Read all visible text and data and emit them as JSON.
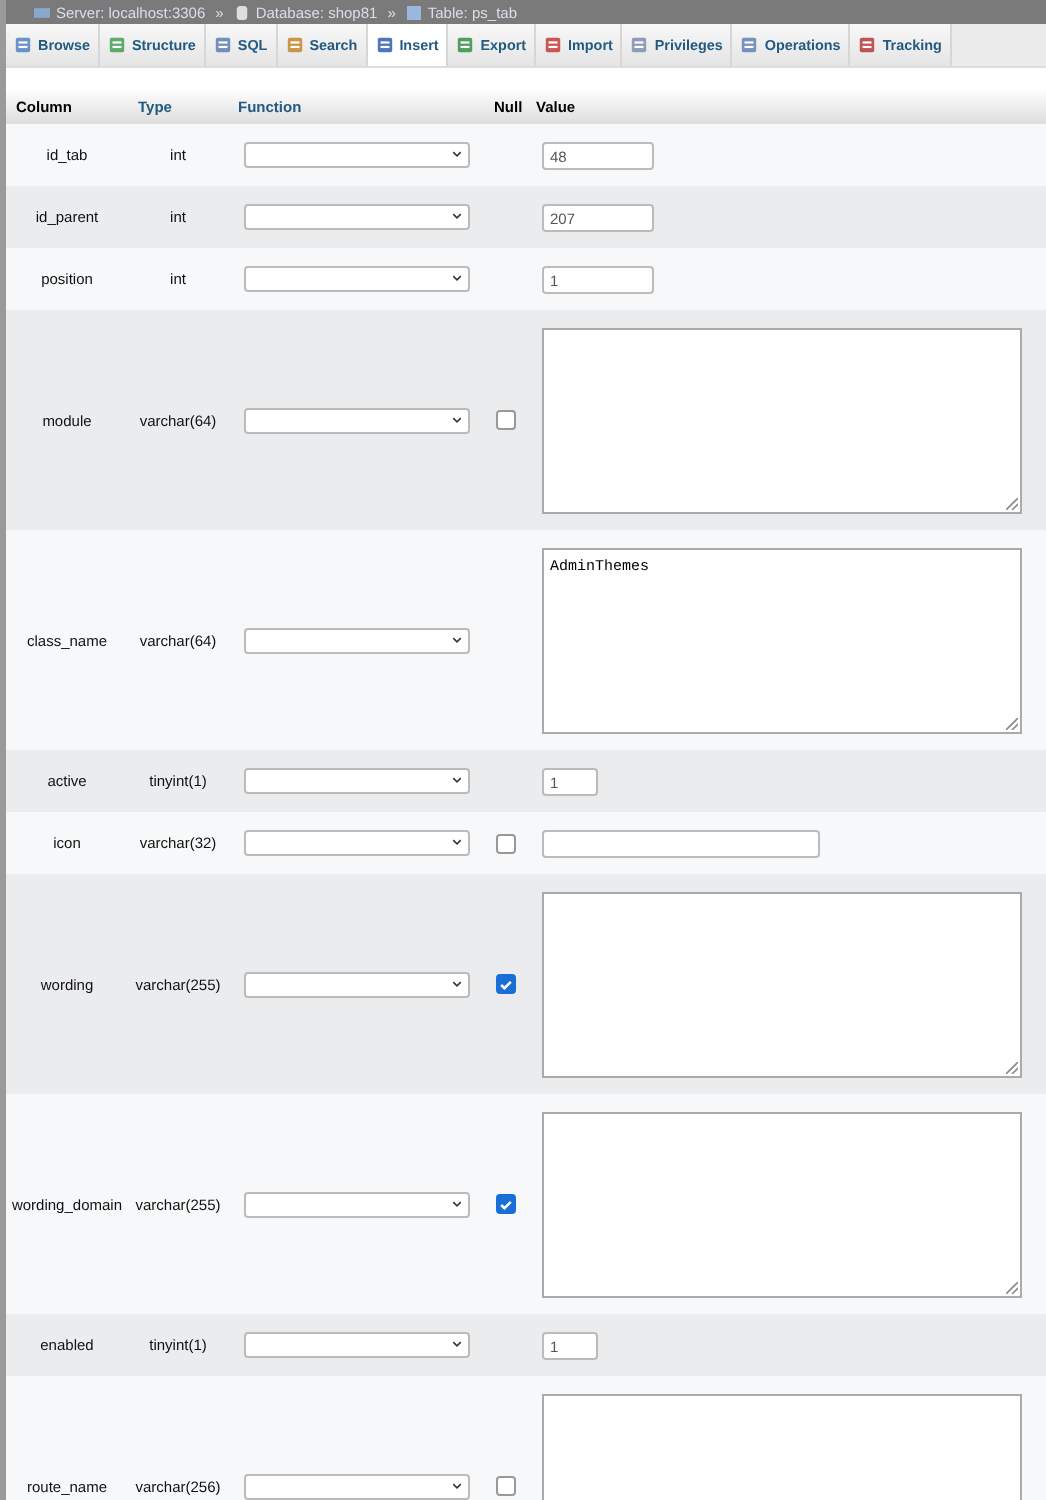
{
  "breadcrumb": {
    "separator": "»",
    "items": [
      {
        "label": "Server: localhost:3306",
        "kind": "server"
      },
      {
        "label": "Database: shop81",
        "kind": "database"
      },
      {
        "label": "Table: ps_tab",
        "kind": "table"
      }
    ]
  },
  "tabs": [
    {
      "label": "Browse",
      "kind": "browse",
      "selected": false
    },
    {
      "label": "Structure",
      "kind": "structure",
      "selected": false
    },
    {
      "label": "SQL",
      "kind": "sql",
      "selected": false
    },
    {
      "label": "Search",
      "kind": "search",
      "selected": false
    },
    {
      "label": "Insert",
      "kind": "insert",
      "selected": true
    },
    {
      "label": "Export",
      "kind": "export",
      "selected": false
    },
    {
      "label": "Import",
      "kind": "import",
      "selected": false
    },
    {
      "label": "Privileges",
      "kind": "privileges",
      "selected": false
    },
    {
      "label": "Operations",
      "kind": "operations",
      "selected": false
    },
    {
      "label": "Tracking",
      "kind": "tracking",
      "selected": false
    }
  ],
  "table": {
    "columns": [
      "Column",
      "Type",
      "Function",
      "Null",
      "Value"
    ],
    "rows": [
      {
        "column": "id_tab",
        "type": "int",
        "value": {
          "kind": "int",
          "text": "48"
        }
      },
      {
        "column": "id_parent",
        "type": "int",
        "value": {
          "kind": "int",
          "text": "207"
        }
      },
      {
        "column": "position",
        "type": "int",
        "value": {
          "kind": "int",
          "text": "1"
        }
      },
      {
        "column": "module",
        "type": "varchar(64)",
        "null": {
          "checked": false
        },
        "value": {
          "kind": "textarea"
        }
      },
      {
        "column": "class_name",
        "type": "varchar(64)",
        "value": {
          "kind": "textarea",
          "text": "AdminThemes"
        }
      },
      {
        "column": "active",
        "type": "tinyint(1)",
        "value": {
          "kind": "tinyint",
          "text": "1"
        }
      },
      {
        "column": "icon",
        "type": "varchar(32)",
        "null": {
          "checked": false
        },
        "value": {
          "kind": "text"
        }
      },
      {
        "column": "wording",
        "type": "varchar(255)",
        "null": {
          "checked": true
        },
        "value": {
          "kind": "textarea"
        }
      },
      {
        "column": "wording_domain",
        "type": "varchar(255)",
        "null": {
          "checked": true
        },
        "value": {
          "kind": "textarea"
        }
      },
      {
        "column": "enabled",
        "type": "tinyint(1)",
        "value": {
          "kind": "tinyint",
          "text": "1"
        }
      },
      {
        "column": "route_name",
        "type": "varchar(256)",
        "null": {
          "checked": false
        },
        "value": {
          "kind": "textarea"
        }
      }
    ]
  }
}
